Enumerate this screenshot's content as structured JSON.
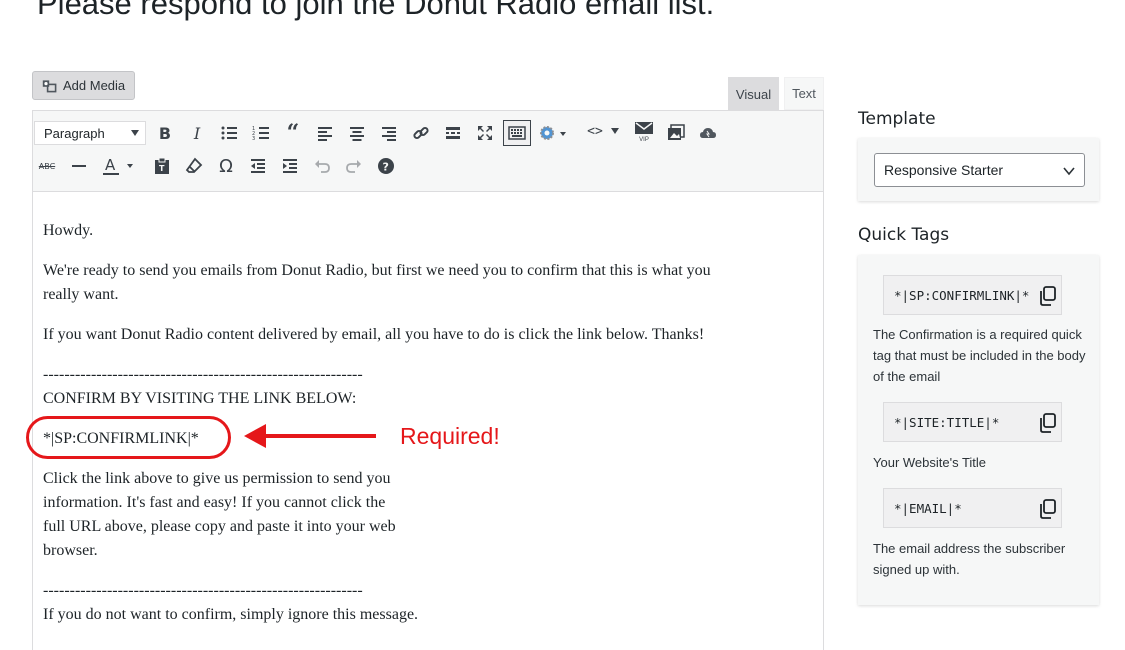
{
  "page": {
    "heading": "Please respond to join the Donut Radio email list."
  },
  "editor": {
    "add_media_label": "Add Media",
    "tabs": {
      "visual": "Visual",
      "text": "Text"
    },
    "toolbar": {
      "format_value": "Paragraph",
      "row1_icons": [
        "bold-icon",
        "italic-icon",
        "bullet-list-icon",
        "numbered-list-icon",
        "blockquote-icon",
        "align-left-icon",
        "align-center-icon",
        "align-right-icon",
        "link-icon",
        "read-more-icon",
        "fullscreen-icon",
        "toolbar-toggle-icon",
        "settings-gear-icon",
        "code-icon",
        "vip-mail-icon",
        "gallery-icon",
        "cloud-icon"
      ],
      "row2_icons": [
        "strikethrough-icon",
        "horizontal-line-icon",
        "text-color-icon",
        "paste-text-icon",
        "clear-format-icon",
        "omega-icon",
        "outdent-icon",
        "indent-icon",
        "undo-icon",
        "redo-icon",
        "help-icon"
      ],
      "vip_label": "VIP"
    },
    "content": {
      "p1": "Howdy.",
      "p2_line1": "We're ready to send you emails from Donut Radio, but first we need you to confirm that this is what you",
      "p2_line2": "really want.",
      "p3": "If you want Donut Radio content delivered by email, all you have to do is click the link below. Thanks!",
      "divider": "------------------------------------------------------------",
      "confirm_heading": "CONFIRM BY VISITING THE LINK BELOW:",
      "confirm_tag": "*|SP:CONFIRMLINK|*",
      "p5_line1": "Click the link above to give us permission to send you",
      "p5_line2": "information. It's fast and easy! If you cannot click the",
      "p5_line3": "full URL above, please copy and paste it into your web",
      "p5_line4": "browser.",
      "p6": "If you do not want to confirm, simply ignore this message."
    },
    "annotation": {
      "label": "Required!",
      "color": "#e5171a"
    }
  },
  "sidebar": {
    "template": {
      "title": "Template",
      "selected": "Responsive Starter"
    },
    "quick_tags": {
      "title": "Quick Tags",
      "items": [
        {
          "tag": "*|SP:CONFIRMLINK|*",
          "description": "The Confirmation is a required quick tag that must be included in the body of the email"
        },
        {
          "tag": "*|SITE:TITLE|*",
          "description": "Your Website's Title"
        },
        {
          "tag": "*|EMAIL|*",
          "description": "The email address the subscriber signed up with."
        }
      ]
    }
  }
}
